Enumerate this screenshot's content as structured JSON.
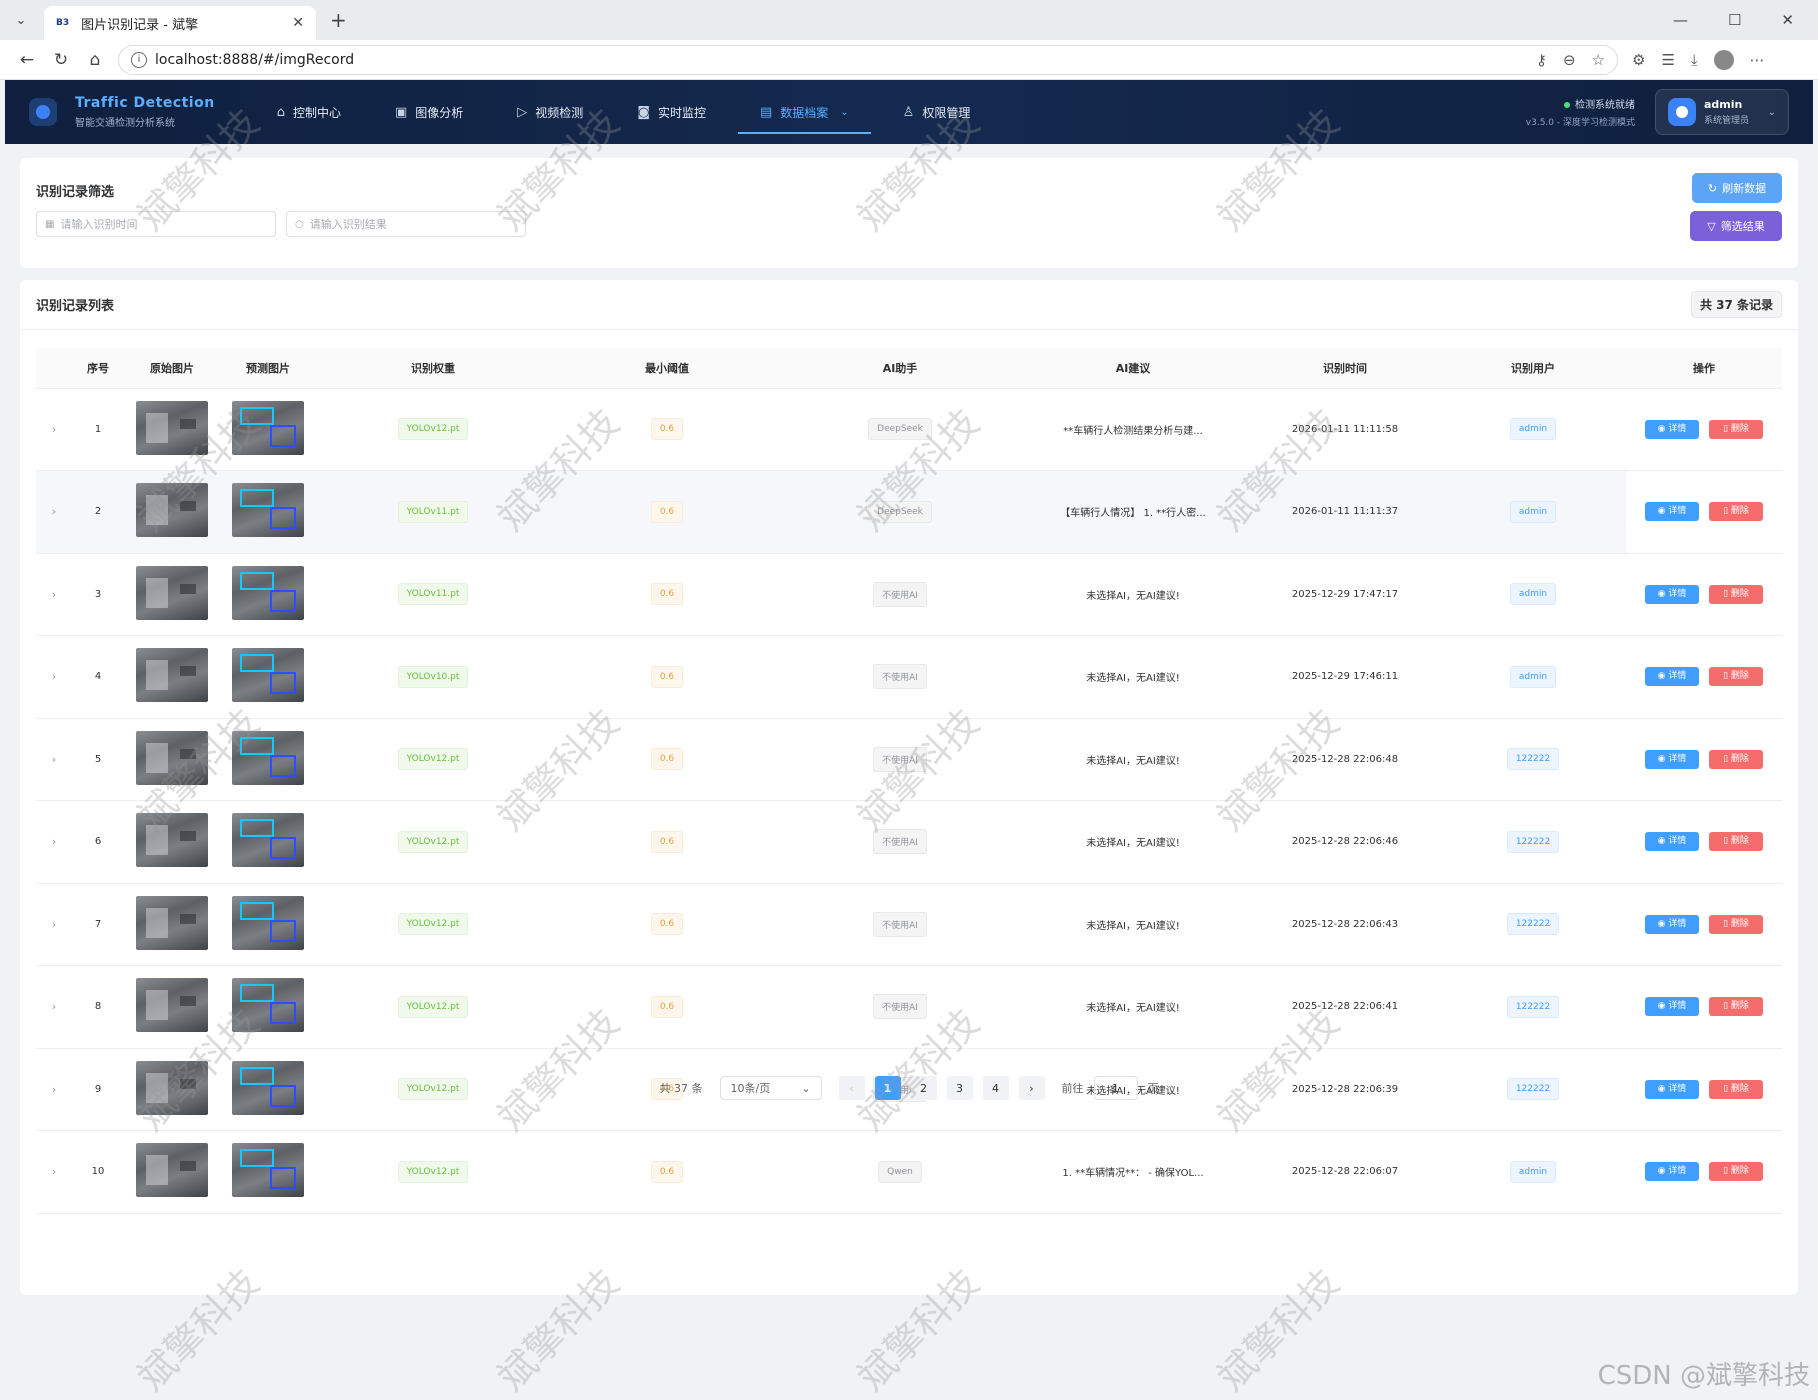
{
  "browser": {
    "tab_favicon": "B3",
    "tab_title": "图片识别记录 - 斌擎",
    "url": "localhost:8888/#/imgRecord"
  },
  "header": {
    "brand_title": "Traffic Detection",
    "brand_subtitle": "智能交通检测分析系统",
    "menu": [
      {
        "label": "控制中心",
        "icon": "home-icon"
      },
      {
        "label": "图像分析",
        "icon": "image-icon"
      },
      {
        "label": "视频检测",
        "icon": "play-icon"
      },
      {
        "label": "实时监控",
        "icon": "camera-icon"
      },
      {
        "label": "数据档案",
        "icon": "document-icon",
        "active": true
      },
      {
        "label": "权限管理",
        "icon": "user-icon"
      }
    ],
    "status_text": "检测系统就绪",
    "version_text": "v3.5.0 - 深度学习检测模式",
    "user_name": "admin",
    "user_role": "系统管理员"
  },
  "filter": {
    "title": "识别记录筛选",
    "time_placeholder": "请输入识别时间",
    "result_placeholder": "请输入识别结果",
    "refresh_label": "刷新数据",
    "filter_label": "筛选结果"
  },
  "list": {
    "title": "识别记录列表",
    "count_label": "共 37 条记录",
    "columns": [
      "序号",
      "原始图片",
      "预测图片",
      "识别权重",
      "最小阈值",
      "AI助手",
      "AI建议",
      "识别时间",
      "识别用户",
      "操作"
    ],
    "detail_label": "详情",
    "delete_label": "删除",
    "rows": [
      {
        "no": "1",
        "weight": "YOLOv12.pt",
        "threshold": "0.6",
        "ai": "DeepSeek",
        "advice": "**车辆行人检测结果分析与建...",
        "time": "2026-01-11 11:11:58",
        "user": "admin"
      },
      {
        "no": "2",
        "weight": "YOLOv11.pt",
        "threshold": "0.6",
        "ai": "DeepSeek",
        "advice": "【车辆行人情况】 1. **行人密...",
        "time": "2026-01-11 11:11:37",
        "user": "admin"
      },
      {
        "no": "3",
        "weight": "YOLOv11.pt",
        "threshold": "0.6",
        "ai": "不使用AI",
        "advice": "未选择AI，无AI建议!",
        "time": "2025-12-29 17:47:17",
        "user": "admin"
      },
      {
        "no": "4",
        "weight": "YOLOv10.pt",
        "threshold": "0.6",
        "ai": "不使用AI",
        "advice": "未选择AI，无AI建议!",
        "time": "2025-12-29 17:46:11",
        "user": "admin"
      },
      {
        "no": "5",
        "weight": "YOLOv12.pt",
        "threshold": "0.6",
        "ai": "不使用AI",
        "advice": "未选择AI，无AI建议!",
        "time": "2025-12-28 22:06:48",
        "user": "122222"
      },
      {
        "no": "6",
        "weight": "YOLOv12.pt",
        "threshold": "0.6",
        "ai": "不使用AI",
        "advice": "未选择AI，无AI建议!",
        "time": "2025-12-28 22:06:46",
        "user": "122222"
      },
      {
        "no": "7",
        "weight": "YOLOv12.pt",
        "threshold": "0.6",
        "ai": "不使用AI",
        "advice": "未选择AI，无AI建议!",
        "time": "2025-12-28 22:06:43",
        "user": "122222"
      },
      {
        "no": "8",
        "weight": "YOLOv12.pt",
        "threshold": "0.6",
        "ai": "不使用AI",
        "advice": "未选择AI，无AI建议!",
        "time": "2025-12-28 22:06:41",
        "user": "122222"
      },
      {
        "no": "9",
        "weight": "YOLOv12.pt",
        "threshold": "0.6",
        "ai": "不使用AI",
        "advice": "未选择AI，无AI建议!",
        "time": "2025-12-28 22:06:39",
        "user": "122222"
      },
      {
        "no": "10",
        "weight": "YOLOv12.pt",
        "threshold": "0.6",
        "ai": "Qwen",
        "advice": "1. **车辆情况**： - 确保YOL...",
        "time": "2025-12-28 22:06:07",
        "user": "admin"
      }
    ]
  },
  "pagination": {
    "total_label": "共 37 条",
    "page_size": "10条/页",
    "pages": [
      "1",
      "2",
      "3",
      "4"
    ],
    "current": "1",
    "goto_label": "前往",
    "goto_value": "1",
    "page_suffix": "页"
  },
  "watermark": {
    "text": "斌擎科技",
    "csdn": "CSDN @斌擎科技"
  }
}
